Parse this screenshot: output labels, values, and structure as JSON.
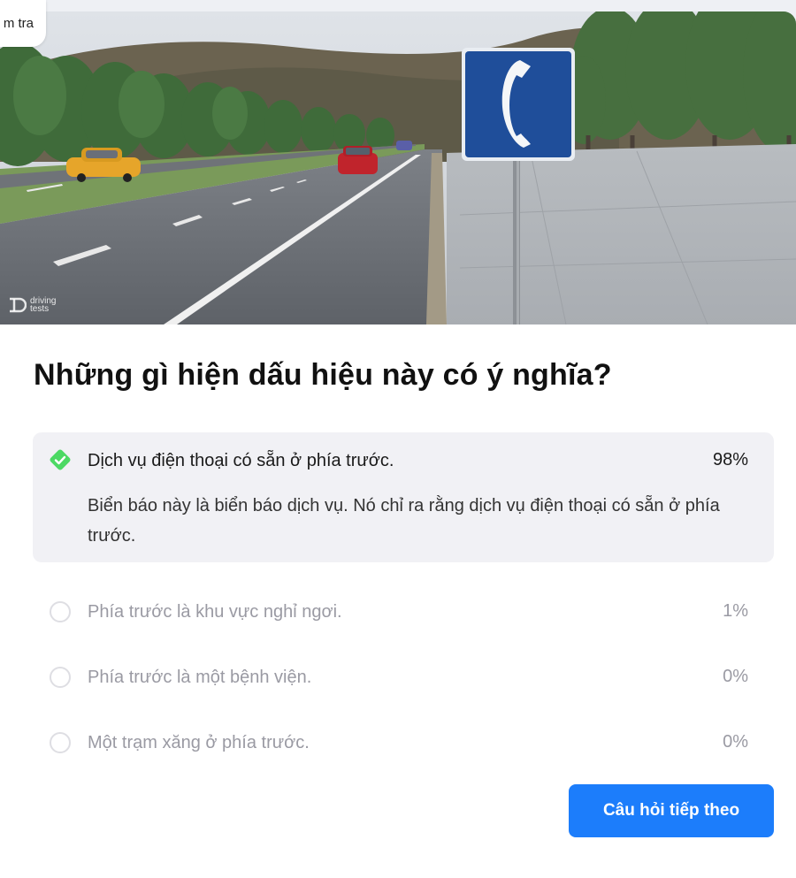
{
  "header": {
    "exit_label": "m tra"
  },
  "image": {
    "watermark_line1": "driving",
    "watermark_line2": "tests",
    "sign_icon": "telephone-icon"
  },
  "question": {
    "text": "Những gì hiện dấu hiệu này có ý nghĩa?"
  },
  "answers": [
    {
      "text": "Dịch vụ điện thoại có sẵn ở phía trước.",
      "percent": "98%",
      "correct": true,
      "explanation": "Biển báo này là biển báo dịch vụ. Nó chỉ ra rằng dịch vụ điện thoại có sẵn ở phía trước."
    },
    {
      "text": "Phía trước là khu vực nghỉ ngơi.",
      "percent": "1%"
    },
    {
      "text": "Phía trước là một bệnh viện.",
      "percent": "0%"
    },
    {
      "text": "Một trạm xăng ở phía trước.",
      "percent": "0%"
    }
  ],
  "actions": {
    "next_label": "Câu hỏi tiếp theo"
  },
  "colors": {
    "accent": "#1c7dfb",
    "correct": "#4cd964",
    "selected_bg": "#f1f1f5"
  }
}
